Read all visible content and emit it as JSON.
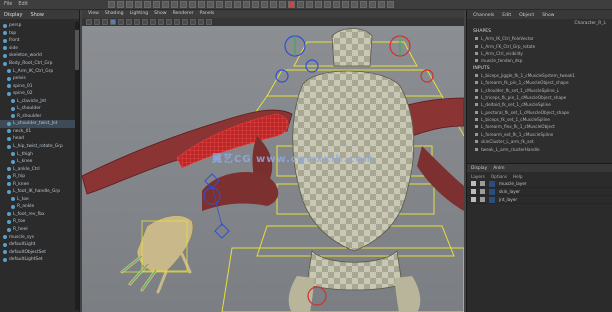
{
  "top_menu": [
    "File",
    "Edit"
  ],
  "outliner": {
    "tabs": [
      "Display",
      "Show"
    ],
    "items": [
      {
        "label": "persp",
        "depth": 0,
        "selected": false
      },
      {
        "label": "top",
        "depth": 0,
        "selected": false
      },
      {
        "label": "front",
        "depth": 0,
        "selected": false
      },
      {
        "label": "side",
        "depth": 0,
        "selected": false
      },
      {
        "label": "skeleton_world",
        "depth": 0,
        "selected": false
      },
      {
        "label": "Body_Root_Ctrl_Grp",
        "depth": 0,
        "selected": false
      },
      {
        "label": "L_Arm_IK_Ctrl_Grp",
        "depth": 1,
        "selected": false
      },
      {
        "label": "pelvis",
        "depth": 1,
        "selected": false
      },
      {
        "label": "spine_01",
        "depth": 1,
        "selected": false
      },
      {
        "label": "spine_02",
        "depth": 1,
        "selected": false
      },
      {
        "label": "L_clavicle_Jnt",
        "depth": 2,
        "selected": false
      },
      {
        "label": "L_shoulder",
        "depth": 2,
        "selected": false
      },
      {
        "label": "R_shoulder",
        "depth": 2,
        "selected": false
      },
      {
        "label": "L_shoulder_twist_Jnt",
        "depth": 1,
        "selected": true
      },
      {
        "label": "neck_01",
        "depth": 1,
        "selected": false
      },
      {
        "label": "head",
        "depth": 1,
        "selected": false
      },
      {
        "label": "L_hip_twist_rotate_Grp",
        "depth": 1,
        "selected": false
      },
      {
        "label": "L_thigh",
        "depth": 2,
        "selected": false
      },
      {
        "label": "L_knee",
        "depth": 2,
        "selected": false
      },
      {
        "label": "L_ankle_Ctrl",
        "depth": 1,
        "selected": false
      },
      {
        "label": "R_hip",
        "depth": 1,
        "selected": false
      },
      {
        "label": "R_knee",
        "depth": 1,
        "selected": false
      },
      {
        "label": "L_foot_IK_handle_Grp",
        "depth": 1,
        "selected": false
      },
      {
        "label": "L_toe",
        "depth": 2,
        "selected": false
      },
      {
        "label": "R_ankle",
        "depth": 2,
        "selected": false
      },
      {
        "label": "L_foot_rev_fbx",
        "depth": 1,
        "selected": false
      },
      {
        "label": "R_toe",
        "depth": 1,
        "selected": false
      },
      {
        "label": "R_heel",
        "depth": 1,
        "selected": false
      },
      {
        "label": "muscle_sys",
        "depth": 0,
        "selected": false
      },
      {
        "label": "defaultLight",
        "depth": 0,
        "selected": false
      },
      {
        "label": "defaultObjectSet",
        "depth": 0,
        "selected": false
      },
      {
        "label": "defaultLightSet",
        "depth": 0,
        "selected": false
      }
    ]
  },
  "viewport": {
    "menu": [
      "View",
      "Shading",
      "Lighting",
      "Show",
      "Renderer",
      "Panels"
    ],
    "watermark": "翼艺CG  www.cgwxxlb.com"
  },
  "right_panel": {
    "tabs": [
      "Channels",
      "Edit",
      "Object",
      "Show"
    ],
    "sub_title": "Character_R_L",
    "shapes_header": "SHAPES",
    "shapes": [
      "L_Arm_IK_Ctrl_PoleVector",
      "L_Arm_FK_Ctrl_Grp_rotate",
      "L_Arm_Ctrl_visibility",
      "muscle_tendon_dsp"
    ],
    "inputs_header": "INPUTS",
    "inputs": [
      "L_biceps_jiggle_fk_1_cMuscleSystem_tweak1",
      "L_forearm_fk_pin_1_cMuscleObject_shape",
      "L_shoulder_fk_set_1_cMuscleSpline_L",
      "L_triceps_fk_pin_1_cMuscleObject_shape",
      "L_deltoid_fk_set_1_cMuscleSpline",
      "L_pectoral_fk_set_1_cMuscleObject_shape",
      "L_biceps_fk_set_1_cMuscleSpline",
      "L_forearm_flex_fk_1_cMuscleObject",
      "L_forearm_ext_fk_1_cMuscleSpline",
      "skinCluster_L_arm_fk_set",
      "tweak_L_arm_clusterHandle"
    ],
    "layer_tabs": [
      "Display",
      "Anim"
    ],
    "layer_menu": [
      "Layers",
      "Options",
      "Help"
    ],
    "layers": [
      {
        "name": "muscle_layer",
        "color": "#2a4d80"
      },
      {
        "name": "skin_layer",
        "color": "#2a4d80"
      },
      {
        "name": "jnt_layer",
        "color": "#2a4d80"
      }
    ]
  },
  "colors": {
    "viewport_bg": "#868a8e",
    "muscle": "#8a3030",
    "selected_muscle": "#d83030",
    "rig_yellow": "#e6e03a",
    "rig_blue": "#3050d0",
    "rig_red": "#d03030",
    "rig_green": "#30b050"
  }
}
